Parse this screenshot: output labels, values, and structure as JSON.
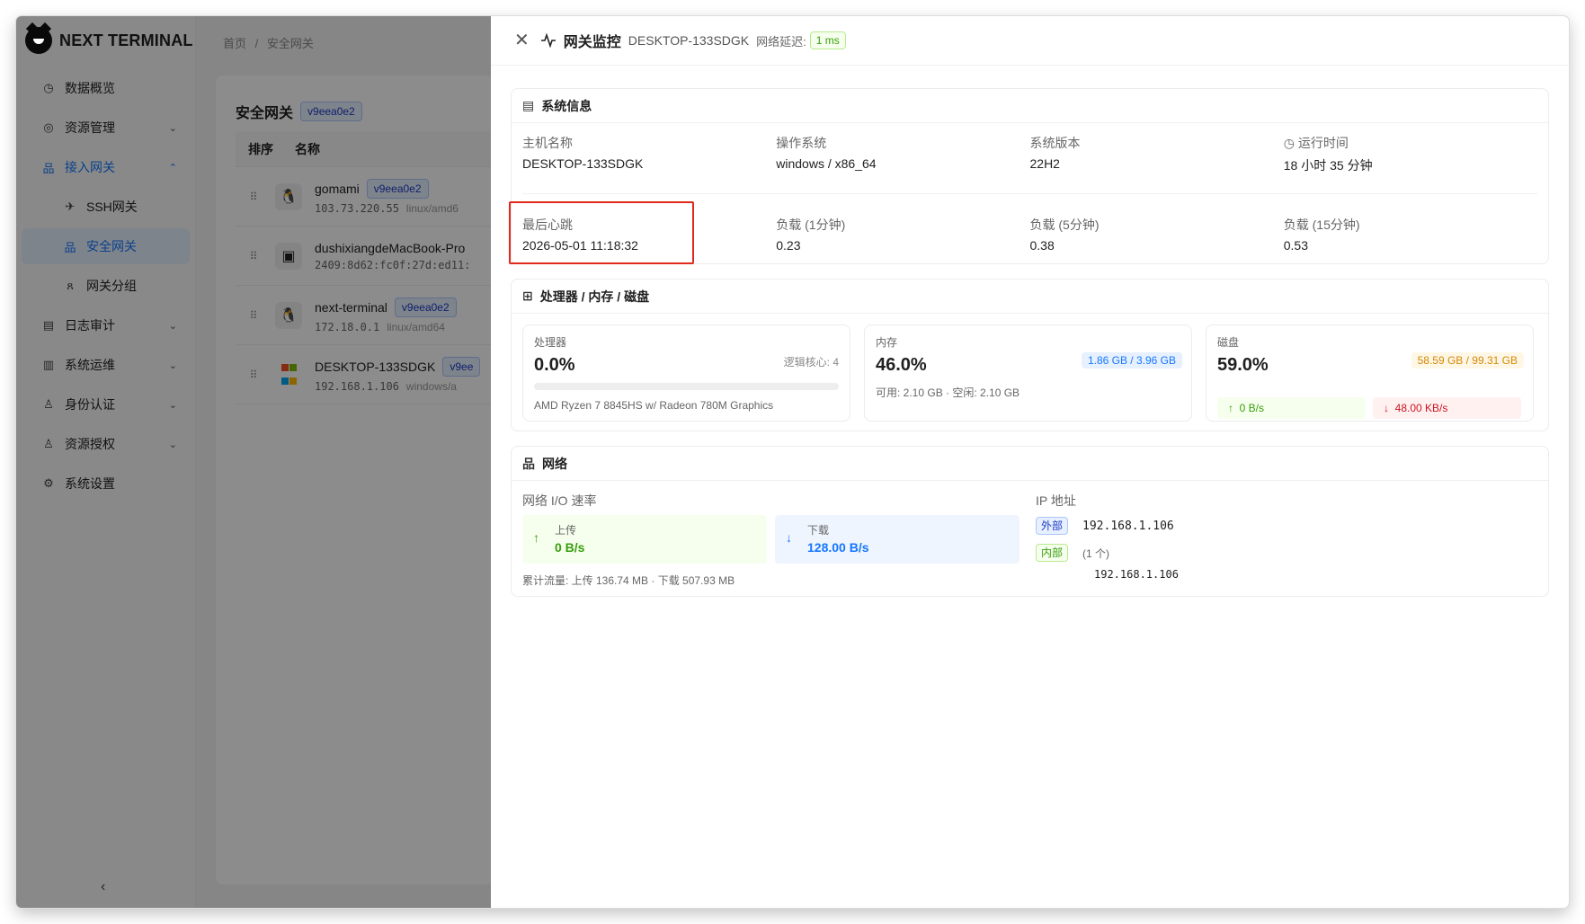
{
  "app": {
    "name": "NEXT TERMINAL"
  },
  "sidebar": {
    "items": [
      {
        "label": "数据概览",
        "icon": "dashboard-icon"
      },
      {
        "label": "资源管理",
        "icon": "cloud-icon"
      },
      {
        "label": "接入网关",
        "icon": "gateway-icon"
      },
      {
        "label": "SSH网关",
        "icon": "rocket-icon"
      },
      {
        "label": "安全网关",
        "icon": "gateway-icon"
      },
      {
        "label": "网关分组",
        "icon": "group-icon"
      },
      {
        "label": "日志审计",
        "icon": "audit-icon"
      },
      {
        "label": "系统运维",
        "icon": "ops-icon"
      },
      {
        "label": "身份认证",
        "icon": "user-icon"
      },
      {
        "label": "资源授权",
        "icon": "user-icon"
      },
      {
        "label": "系统设置",
        "icon": "gear-icon"
      }
    ]
  },
  "breadcrumb": {
    "home": "首页",
    "sep": "/",
    "current": "安全网关"
  },
  "list": {
    "title": "安全网关",
    "version": "v9eea0e2",
    "columns": [
      "排序",
      "名称"
    ],
    "rows": [
      {
        "name": "gomami",
        "version": "v9eea0e2",
        "ip": "103.73.220.55",
        "os": "linux/amd6"
      },
      {
        "name": "dushixiangdeMacBook-Pro",
        "version": "",
        "ip": "2409:8d62:fc0f:27d:ed11:",
        "os": ""
      },
      {
        "name": "next-terminal",
        "version": "v9eea0e2",
        "ip": "172.18.0.1",
        "os": "linux/amd64"
      },
      {
        "name": "DESKTOP-133SDGK",
        "version": "v9ee",
        "ip": "192.168.1.106",
        "os": "windows/a"
      }
    ]
  },
  "drawer": {
    "title": "网关监控",
    "host": "DESKTOP-133SDGK",
    "latency_label": "网络延迟:",
    "latency": "1 ms",
    "system": {
      "title": "系统信息",
      "hostname_label": "主机名称",
      "hostname": "DESKTOP-133SDGK",
      "os_label": "操作系统",
      "os": "windows / x86_64",
      "version_label": "系统版本",
      "version": "22H2",
      "uptime_label": "运行时间",
      "uptime": "18 小时 35 分钟",
      "heartbeat_label": "最后心跳",
      "heartbeat": "2026-05-01 11:18:32",
      "load1_label": "负载 (1分钟)",
      "load1": "0.23",
      "load5_label": "负载 (5分钟)",
      "load5": "0.38",
      "load15_label": "负载 (15分钟)",
      "load15": "0.53"
    },
    "hw": {
      "title": "处理器 / 内存 / 磁盘",
      "cpu_label": "处理器",
      "cpu_value": "0.0%",
      "cpu_percent": 0.0,
      "cores": "逻辑核心: 4",
      "cpu_model": "AMD Ryzen 7 8845HS w/ Radeon 780M Graphics",
      "mem_label": "内存",
      "mem_value": "46.0%",
      "mem_tag": "1.86 GB / 3.96 GB",
      "mem_detail": "可用: 2.10 GB · 空闲: 2.10 GB",
      "disk_label": "磁盘",
      "disk_value": "59.0%",
      "disk_tag": "58.59 GB / 99.31 GB",
      "disk_read": "0 B/s",
      "disk_write": "48.00 KB/s"
    },
    "net": {
      "title": "网络",
      "io_label": "网络 I/O 速率",
      "up_label": "上传",
      "up_value": "0 B/s",
      "down_label": "下载",
      "down_value": "128.00 B/s",
      "total": "累计流量: 上传 136.74 MB · 下载 507.93 MB",
      "ip_label": "IP 地址",
      "ext_label": "外部",
      "ext_ip": "192.168.1.106",
      "int_label": "内部",
      "int_count": "(1 个)",
      "int_ip": "192.168.1.106"
    }
  }
}
